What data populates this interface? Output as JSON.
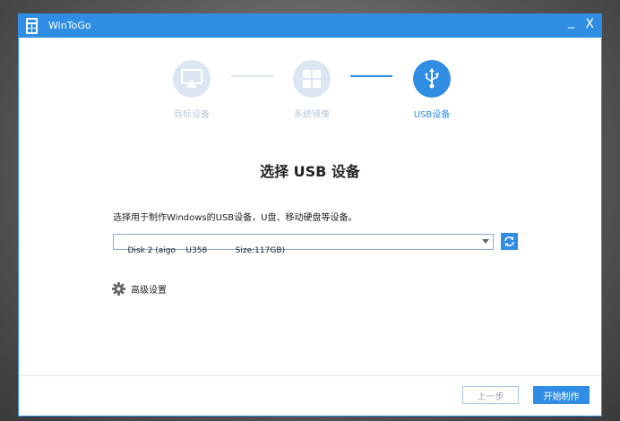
{
  "window": {
    "title": "WinToGo",
    "minimize": "_",
    "close": "X"
  },
  "steps": [
    {
      "label": "目标设备",
      "state": "done"
    },
    {
      "label": "系统镜像",
      "state": "done"
    },
    {
      "label": "USB设备",
      "state": "active"
    }
  ],
  "main": {
    "heading": "选择 USB 设备",
    "instruction": "选择用于制作Windows的USB设备，U盘、移动硬盘等设备。",
    "device_select": {
      "value": "Disk 2 (aigo    U358           Size:117GB)"
    },
    "advanced_label": "高级设置"
  },
  "footer": {
    "prev_label": "上一步",
    "start_label": "开始制作"
  },
  "colors": {
    "accent": "#2f8de4",
    "inactive": "#dbe6f2"
  }
}
